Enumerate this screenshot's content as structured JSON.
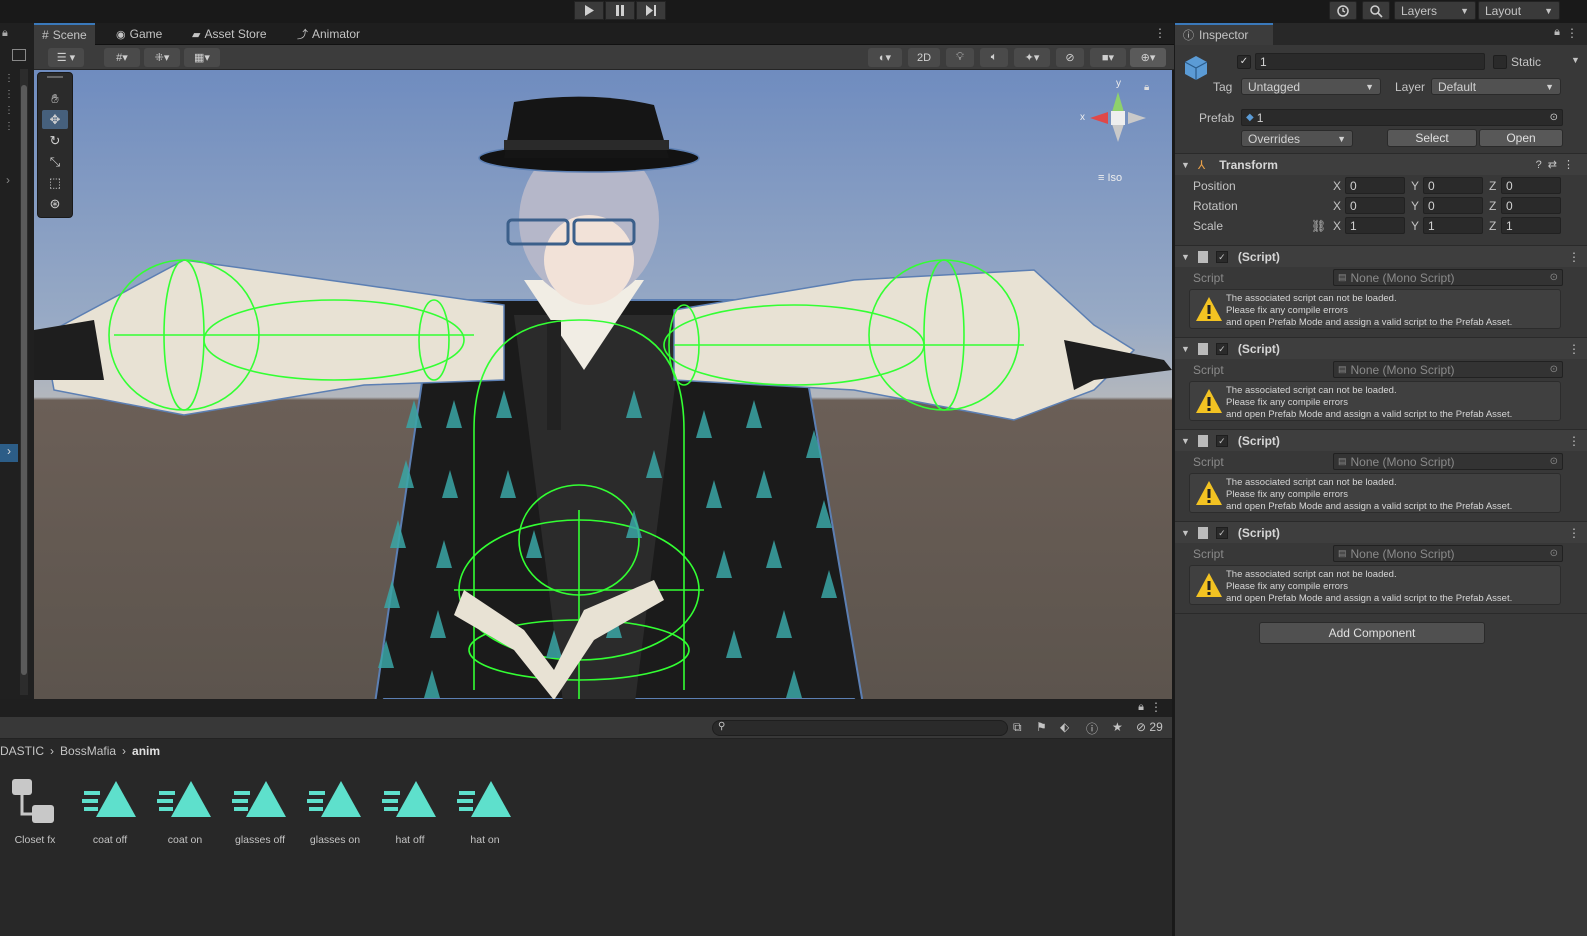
{
  "toolbar": {
    "play_icon": "play-icon",
    "pause_icon": "pause-icon",
    "step_icon": "step-icon",
    "layers_label": "Layers",
    "layout_label": "Layout"
  },
  "scene_tabs": [
    {
      "label": "Scene",
      "icon": "hashtag-icon"
    },
    {
      "label": "Game",
      "icon": "gamepad-icon"
    },
    {
      "label": "Asset Store",
      "icon": "bag-icon"
    },
    {
      "label": "Animator",
      "icon": "animator-icon"
    }
  ],
  "scene_toolbar": {
    "mode_2d": "2D"
  },
  "viewport": {
    "gizmo_x": "x",
    "gizmo_y": "y",
    "projection_label": "Iso"
  },
  "inspector": {
    "tab_label": "Inspector",
    "object_name": "1",
    "static_label": "Static",
    "tag_label": "Tag",
    "tag_value": "Untagged",
    "layer_label": "Layer",
    "layer_value": "Default",
    "prefab_label": "Prefab",
    "prefab_value": "1",
    "overrides_label": "Overrides",
    "select_label": "Select",
    "open_label": "Open",
    "transform": {
      "title": "Transform",
      "rows": [
        {
          "label": "Position",
          "x": "0",
          "y": "0",
          "z": "0"
        },
        {
          "label": "Rotation",
          "x": "0",
          "y": "0",
          "z": "0"
        },
        {
          "label": "Scale",
          "x": "1",
          "y": "1",
          "z": "1"
        }
      ],
      "axis_x": "X",
      "axis_y": "Y",
      "axis_z": "Z"
    },
    "scripts": [
      {
        "title": "(Script)",
        "field_label": "Script",
        "field_value": "None (Mono Script)",
        "warn1": "The associated script can not be loaded.",
        "warn2": "Please fix any compile errors",
        "warn3": "and open Prefab Mode and assign a valid script to the Prefab Asset."
      },
      {
        "title": "(Script)",
        "field_label": "Script",
        "field_value": "None (Mono Script)",
        "warn1": "The associated script can not be loaded.",
        "warn2": "Please fix any compile errors",
        "warn3": "and open Prefab Mode and assign a valid script to the Prefab Asset."
      },
      {
        "title": "(Script)",
        "field_label": "Script",
        "field_value": "None (Mono Script)",
        "warn1": "The associated script can not be loaded.",
        "warn2": "Please fix any compile errors",
        "warn3": "and open Prefab Mode and assign a valid script to the Prefab Asset."
      },
      {
        "title": "(Script)",
        "field_label": "Script",
        "field_value": "None (Mono Script)",
        "warn1": "The associated script can not be loaded.",
        "warn2": "Please fix any compile errors",
        "warn3": "and open Prefab Mode and assign a valid script to the Prefab Asset."
      }
    ],
    "add_component_label": "Add Component"
  },
  "project": {
    "breadcrumb": [
      "DASTIC",
      "BossMafia",
      "anim"
    ],
    "hidden_count": "29",
    "assets": [
      {
        "name": "Closet fx",
        "type": "controller"
      },
      {
        "name": "coat off",
        "type": "anim"
      },
      {
        "name": "coat on",
        "type": "anim"
      },
      {
        "name": "glasses off",
        "type": "anim"
      },
      {
        "name": "glasses on",
        "type": "anim"
      },
      {
        "name": "hat off",
        "type": "anim"
      },
      {
        "name": "hat on",
        "type": "anim"
      }
    ]
  },
  "colors": {
    "accent": "#3a79bb",
    "anim_icon": "#5ee0cc",
    "warning": "#f3c322",
    "collider_green": "#33ff33"
  }
}
